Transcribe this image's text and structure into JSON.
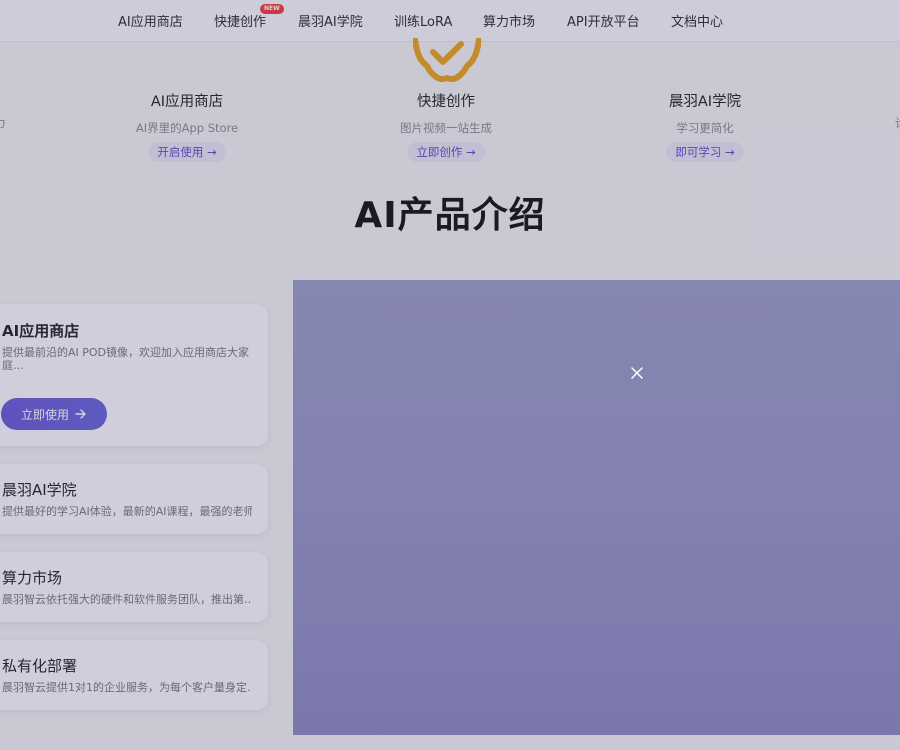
{
  "nav": {
    "items": [
      "AI应用商店",
      "快捷创作",
      "晨羽AI学院",
      "训练LoRA",
      "算力市场",
      "API开放平台",
      "文档中心"
    ],
    "new_badge": "NEW"
  },
  "features": {
    "left_fragment": "力",
    "right_fragment": "论",
    "items": [
      {
        "title": "AI应用商店",
        "subtitle": "AI界里的App Store",
        "button": "开启使用 →"
      },
      {
        "title": "快捷创作",
        "subtitle": "图片视频一站生成",
        "button": "立即创作 →"
      },
      {
        "title": "晨羽AI学院",
        "subtitle": "学习更简化",
        "button": "即可学习 →"
      }
    ]
  },
  "section": {
    "title": "AI产品介绍"
  },
  "cards": [
    {
      "title": "AI应用商店",
      "desc": "提供最前沿的AI POD镜像，欢迎加入应用商店大家庭…",
      "button": "立即使用"
    },
    {
      "title": "晨羽AI学院",
      "desc": "提供最好的学习AI体验，最新的AI课程，最强的老师…"
    },
    {
      "title": "算力市场",
      "desc": "晨羽智云依托强大的硬件和软件服务团队，推出第…"
    },
    {
      "title": "私有化部署",
      "desc": "晨羽智云提供1对1的企业服务，为每个客户量身定…"
    }
  ],
  "colors": {
    "accent": "#6a5ad6",
    "badge": "#ef3b3b",
    "feature_icon": "#e8a41c",
    "video_panel": "#9a9dc8"
  },
  "icons": {
    "feature": "badge-check-icon",
    "arrow": "arrow-right-icon",
    "close": "close-icon"
  }
}
